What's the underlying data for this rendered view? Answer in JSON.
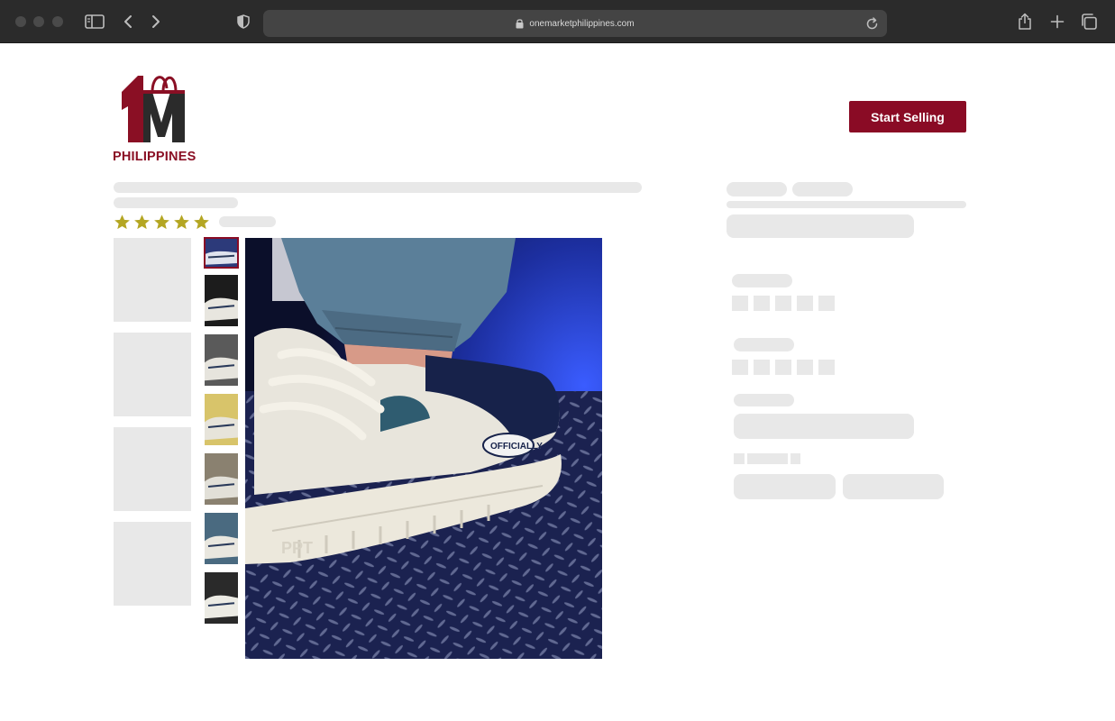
{
  "browser": {
    "url": "onemarketphilippines.com",
    "icons": [
      "sidebar-icon",
      "back-icon",
      "forward-icon",
      "shield-icon",
      "lock-icon",
      "reload-icon",
      "share-icon",
      "new-tab-icon",
      "tabs-icon"
    ]
  },
  "header": {
    "brand_wordmark": "PHILIPPINES",
    "cta_label": "Start Selling",
    "colors": {
      "brand": "#8a0b25",
      "accent_gold": "#b4a623"
    }
  },
  "product": {
    "rating_stars": 5,
    "thumbnails": [
      "sneaker-thumb-1",
      "sneaker-thumb-2",
      "sneaker-thumb-3",
      "sneaker-thumb-4",
      "sneaker-thumb-5",
      "sneaker-thumb-6",
      "sneaker-thumb-7"
    ],
    "selected_thumbnail": 1,
    "main_image": "white and navy chunky sneaker on blue-lit metal floor",
    "shoe_print": "OFFICIALLY"
  }
}
